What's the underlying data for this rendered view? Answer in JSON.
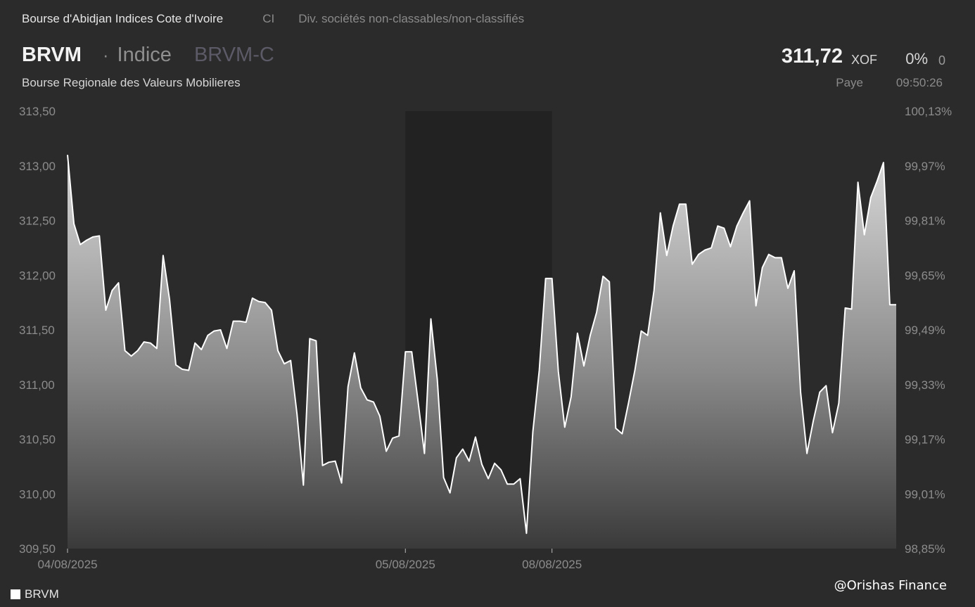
{
  "header": {
    "exchange": "Bourse d'Abidjan Indices Cote d'Ivoire",
    "country_code": "CI",
    "sector": "Div. sociétés non-classables/non-classifiés",
    "symbol": "BRVM",
    "separator": "·",
    "instrument_type": "Indice",
    "code": "BRVM-C",
    "full_name": "Bourse Regionale des Valeurs Mobilieres",
    "price": "311,72",
    "currency": "XOF",
    "change_pct": "0%",
    "change_abs": "0",
    "country": "Paye",
    "time": "09:50:26"
  },
  "colors": {
    "background": "#2b2b2b",
    "line": "#ffffff",
    "shaded_session": "#222222"
  },
  "chart_data": {
    "type": "area",
    "series": [
      {
        "name": "BRVM",
        "values": [
          313.1,
          312.47,
          312.28,
          312.32,
          312.35,
          312.36,
          311.68,
          311.86,
          311.93,
          311.31,
          311.26,
          311.31,
          311.39,
          311.38,
          311.33,
          312.18,
          311.78,
          311.18,
          311.14,
          311.13,
          311.38,
          311.32,
          311.45,
          311.49,
          311.5,
          311.33,
          311.58,
          311.58,
          311.57,
          311.79,
          311.76,
          311.75,
          311.68,
          311.31,
          311.19,
          311.22,
          310.73,
          310.08,
          311.42,
          311.4,
          310.26,
          310.29,
          310.3,
          310.1,
          310.98,
          311.29,
          310.97,
          310.86,
          310.84,
          310.71,
          310.39,
          310.51,
          310.53,
          311.3,
          311.3,
          310.84,
          310.37,
          311.6,
          311.05,
          310.15,
          310.01,
          310.33,
          310.41,
          310.3,
          310.52,
          310.27,
          310.14,
          310.28,
          310.22,
          310.09,
          310.09,
          310.14,
          309.64,
          310.57,
          311.13,
          311.97,
          311.97,
          311.12,
          310.61,
          310.89,
          311.47,
          311.17,
          311.45,
          311.66,
          311.99,
          311.94,
          310.6,
          310.55,
          310.83,
          311.13,
          311.49,
          311.45,
          311.86,
          312.57,
          312.18,
          312.45,
          312.65,
          312.65,
          312.1,
          312.19,
          312.23,
          312.25,
          312.45,
          312.43,
          312.26,
          312.45,
          312.57,
          312.68,
          311.72,
          312.07,
          312.19,
          312.16,
          312.16,
          311.88,
          312.04,
          310.93,
          310.37,
          310.67,
          310.93,
          310.99,
          310.56,
          310.83,
          311.7,
          311.69,
          312.85,
          312.37,
          312.71,
          312.86,
          313.03,
          311.73,
          311.73
        ]
      }
    ],
    "x_ticks": [
      "04/08/2025",
      "05/08/2025",
      "08/08/2025"
    ],
    "x_tick_index": [
      0,
      53,
      76
    ],
    "shaded_range_index": [
      53,
      76
    ],
    "ylim": [
      309.5,
      313.5
    ],
    "y_ticks": [
      "313,50",
      "313,00",
      "312,50",
      "312,00",
      "311,50",
      "311,00",
      "310,50",
      "310,00",
      "309,50"
    ],
    "y_tick_values": [
      313.5,
      313.0,
      312.5,
      312.0,
      311.5,
      311.0,
      310.5,
      310.0,
      309.5
    ],
    "y2_ticks": [
      "100,13%",
      "99,97%",
      "99,81%",
      "99,65%",
      "99,49%",
      "99,33%",
      "99,17%",
      "99,01%",
      "98,85%"
    ],
    "grid": false,
    "legend_position": "bottom-left"
  },
  "legend": {
    "label": "BRVM"
  },
  "watermark": "@Orishas Finance"
}
